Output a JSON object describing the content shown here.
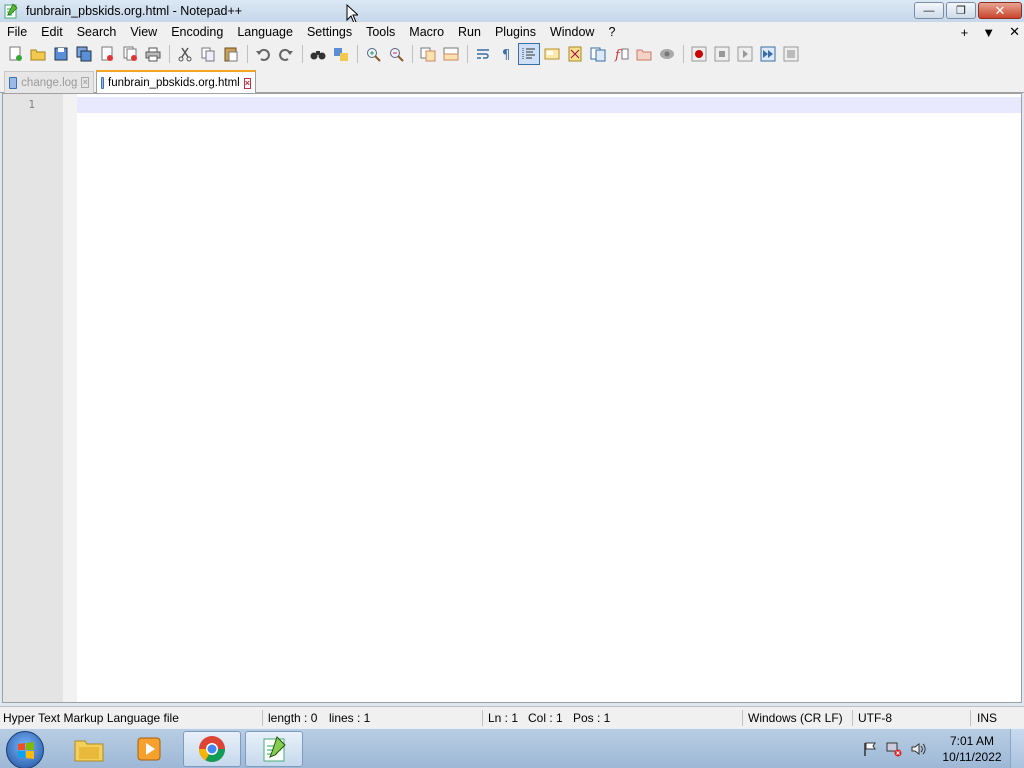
{
  "window": {
    "title": "funbrain_pbskids.org.html - Notepad++",
    "minimize_label": "—",
    "restore_label": "❐",
    "close_label": "✕"
  },
  "menu": {
    "items": [
      "File",
      "Edit",
      "Search",
      "View",
      "Encoding",
      "Language",
      "Settings",
      "Tools",
      "Macro",
      "Run",
      "Plugins",
      "Window",
      "?"
    ],
    "right_plus": "+",
    "right_dropdown": "▼",
    "right_close": "✕"
  },
  "tabs": [
    {
      "label": "change.log",
      "active": false
    },
    {
      "label": "funbrain_pbskids.org.html",
      "active": true
    }
  ],
  "editor": {
    "line_number": "1"
  },
  "status": {
    "file_type": "Hyper Text Markup Language file",
    "length": "length : 0",
    "lines": "lines : 1",
    "ln": "Ln : 1",
    "col": "Col : 1",
    "pos": "Pos : 1",
    "eol": "Windows (CR LF)",
    "encoding": "UTF-8",
    "mode": "INS"
  },
  "taskbar": {
    "apps": [
      "windows-explorer",
      "media-player",
      "chrome",
      "notepad-plus-plus"
    ],
    "time": "7:01 AM",
    "date": "10/11/2022"
  },
  "colors": {
    "active_tab_accent": "#f4a623",
    "current_line": "#e8e8ff",
    "gutter": "#e4e4e4"
  }
}
